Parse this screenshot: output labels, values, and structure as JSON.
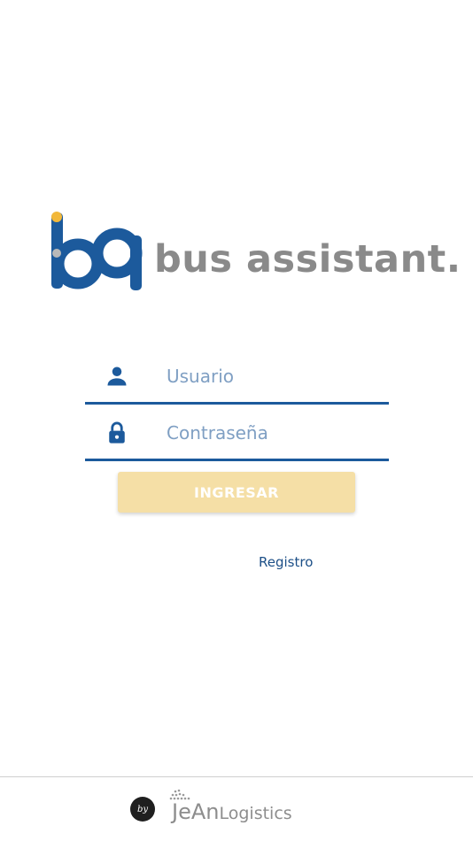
{
  "app": {
    "brand_name": "bus assistant.",
    "logo_icon": "bq-logo",
    "colors": {
      "primary_blue": "#1c5a9c",
      "brand_gray": "#8a8a8a",
      "button_bg": "#f5dfa6",
      "accent_yellow": "#f2b83a"
    }
  },
  "login": {
    "username": {
      "icon": "user-icon",
      "placeholder": "Usuario",
      "value": ""
    },
    "password": {
      "icon": "lock-icon",
      "placeholder": "Contraseña",
      "value": ""
    },
    "submit_label": "INGRESAR",
    "register_label": "Registro"
  },
  "footer": {
    "by_badge": "by",
    "company_icon": "jean-logistics-logo",
    "company_name_part1": "JeAn",
    "company_name_part2": "Logistics"
  }
}
